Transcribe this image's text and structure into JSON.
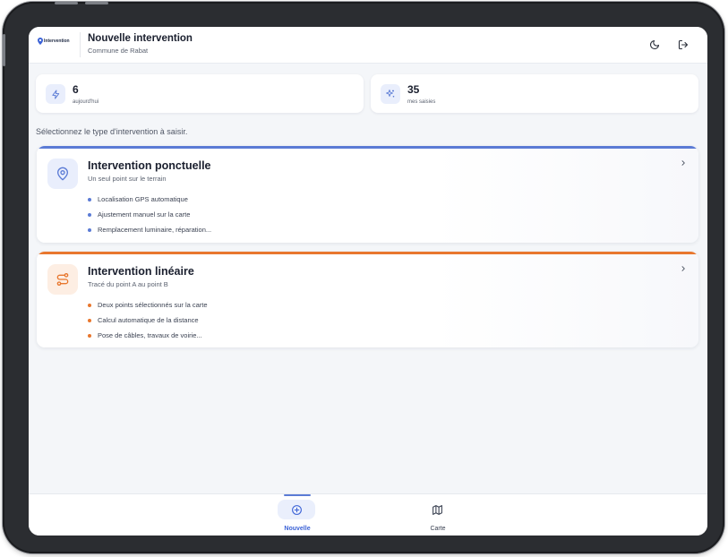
{
  "app": {
    "logo_text": "Intervention",
    "title": "Nouvelle intervention",
    "subtitle": "Commune de Rabat",
    "icons": {
      "theme": "moon-icon",
      "logout": "logout-icon"
    }
  },
  "stats": [
    {
      "value": "6",
      "label": "aujourd'hui",
      "icon": "bolt-icon"
    },
    {
      "value": "35",
      "label": "mes saisies",
      "icon": "sparkle-icon"
    }
  ],
  "instruction": "Sélectionnez le type d'intervention à saisir.",
  "types": [
    {
      "title": "Intervention ponctuelle",
      "subtitle": "Un seul point sur le terrain",
      "icon": "map-pin-icon",
      "accent_color": "#5b7bd5",
      "features": [
        "Localisation GPS automatique",
        "Ajustement manuel sur la carte",
        "Remplacement luminaire, réparation..."
      ]
    },
    {
      "title": "Intervention linéaire",
      "subtitle": "Tracé du point A au point B",
      "icon": "route-icon",
      "accent_color": "#e8772e",
      "features": [
        "Deux points sélectionnés sur la carte",
        "Calcul automatique de la distance",
        "Pose de câbles, travaux de voirie..."
      ]
    }
  ],
  "nav": {
    "items": [
      {
        "label": "Nouvelle",
        "icon": "plus-circle-icon",
        "active": true
      },
      {
        "label": "Carte",
        "icon": "map-icon",
        "active": false
      }
    ]
  },
  "colors": {
    "primary": "#5b7bd5",
    "orange": "#e8772e",
    "background": "#f4f6f9"
  }
}
